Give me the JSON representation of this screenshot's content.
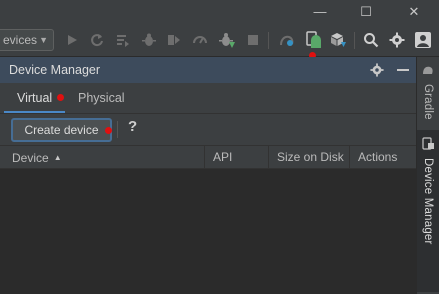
{
  "window_controls": {
    "minimize": "—",
    "maximize": "☐",
    "close": "✕"
  },
  "toolbar": {
    "config_label": "evices",
    "icons": [
      "run-icon",
      "apply-changes-icon",
      "apply-code-changes-icon",
      "debug-icon",
      "profile-icon",
      "attach-debugger-icon",
      "apply-changes-restart-icon",
      "stop-icon",
      "sync-gradle-icon",
      "device-manager-icon",
      "sdk-manager-icon",
      "search-icon",
      "settings-icon",
      "account-icon"
    ]
  },
  "panel": {
    "title": "Device Manager",
    "tabs": [
      {
        "label": "Virtual",
        "selected": true
      },
      {
        "label": "Physical",
        "selected": false
      }
    ],
    "create_button": "Create device",
    "help_label": "?",
    "columns": [
      "Device",
      "API",
      "Size on Disk",
      "Actions"
    ],
    "rows": []
  },
  "right_strip": {
    "tabs": [
      {
        "label": "Gradle",
        "active": false
      },
      {
        "label": "Device Manager",
        "active": true
      }
    ]
  },
  "colors": {
    "accent": "#4a88c7",
    "panel_header": "#3d4b5c",
    "background": "#3c3f41",
    "marker": "#e01010"
  }
}
